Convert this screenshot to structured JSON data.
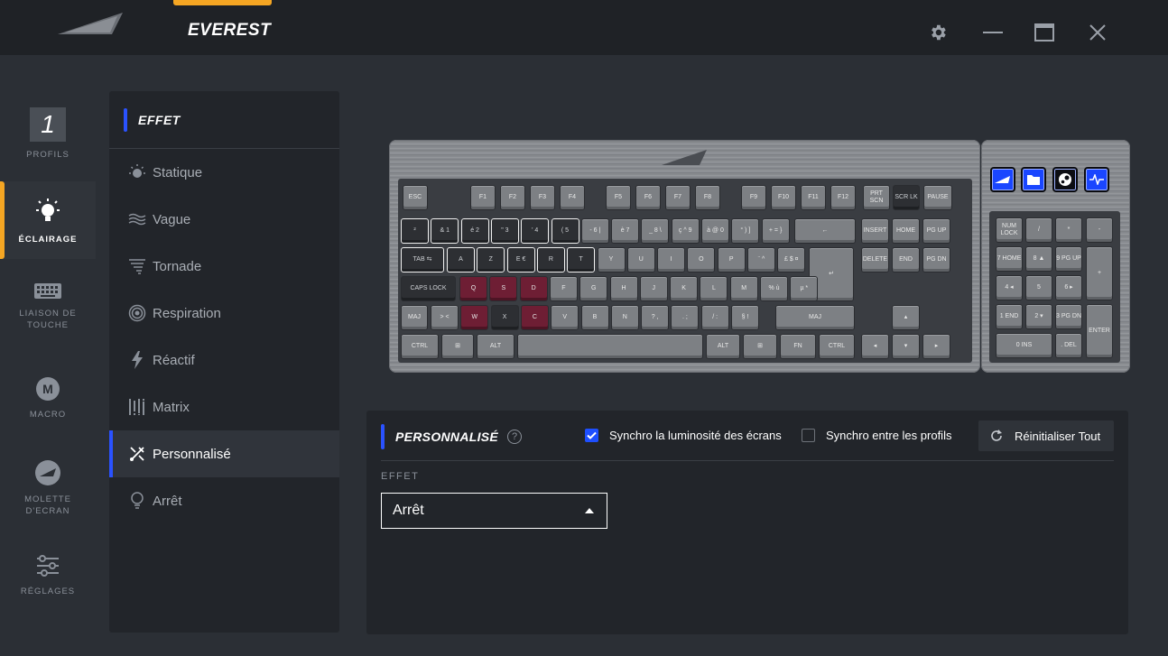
{
  "app": {
    "device_name": "EVEREST",
    "brand_color": "#f5a623",
    "accent_color": "#2a52ff"
  },
  "window_controls": {
    "settings_icon": "gear-icon",
    "minimize_icon": "minimize-icon",
    "maximize_icon": "maximize-icon",
    "close_icon": "close-icon"
  },
  "rail": {
    "profile_number": "1",
    "items": [
      {
        "label": "PROFILS",
        "icon": "profile-number-box"
      },
      {
        "label": "ÉCLAIRAGE",
        "icon": "lightbulb-icon",
        "active": true
      },
      {
        "label": "LIAISON DE TOUCHE",
        "icon": "keyboard-icon"
      },
      {
        "label": "MACRO",
        "icon": "macro-m-icon"
      },
      {
        "label": "MOLETTE D'ECRAN",
        "icon": "dial-icon"
      },
      {
        "label": "RÉGLAGES",
        "icon": "sliders-icon"
      }
    ]
  },
  "effects": {
    "header": "EFFET",
    "items": [
      {
        "label": "Statique",
        "icon": "sun-icon"
      },
      {
        "label": "Vague",
        "icon": "wave-icon"
      },
      {
        "label": "Tornade",
        "icon": "tornado-icon"
      },
      {
        "label": "Respiration",
        "icon": "breathing-icon"
      },
      {
        "label": "Réactif",
        "icon": "lightning-icon"
      },
      {
        "label": "Matrix",
        "icon": "matrix-icon"
      },
      {
        "label": "Personnalisé",
        "icon": "custom-brush-icon",
        "active": true
      },
      {
        "label": "Arrêt",
        "icon": "bulb-off-icon"
      }
    ]
  },
  "keyboard": {
    "function_row": [
      "ESC",
      "F1",
      "F2",
      "F3",
      "F4",
      "F5",
      "F6",
      "F7",
      "F8",
      "F9",
      "F10",
      "F11",
      "F12",
      "PRT SCN",
      "SCR LK",
      "PAUSE"
    ],
    "nav_top": [
      "INSERT",
      "HOME",
      "PG UP"
    ],
    "nav_mid": [
      "DELETE",
      "END",
      "PG DN"
    ],
    "numpad": [
      "NUM LOCK",
      "/",
      "*",
      "-",
      "7 HOME",
      "8 ▲",
      "9 PG UP",
      "+",
      "4 ◂",
      "5",
      "6 ▸",
      "1 END",
      "2 ▾",
      "3 PG DN",
      "ENTER",
      "0 INS",
      ". DEL"
    ],
    "media_keys": [
      "media-logo-key",
      "folder-key",
      "steam-key",
      "pulse-key"
    ],
    "row1": [
      "²",
      "& 1",
      "é 2",
      "\" 3",
      "' 4",
      "( 5",
      "- 6 |",
      "è 7",
      "_ 8 \\",
      "ç ^ 9",
      "à @ 0",
      "° ) ]",
      "+ = }",
      "←"
    ],
    "row2": [
      "TAB ⇆",
      "A",
      "Z",
      "E €",
      "R",
      "T",
      "Y",
      "U",
      "I",
      "O",
      "P",
      "¨ ^",
      "£ $ ¤",
      "↵"
    ],
    "row3": [
      "CAPS LOCK",
      "Q",
      "S",
      "D",
      "F",
      "G",
      "H",
      "J",
      "K",
      "L",
      "M",
      "% ù",
      "µ *"
    ],
    "row4": [
      "MAJ",
      "> <",
      "W",
      "X",
      "C",
      "V",
      "B",
      "N",
      "? ,",
      ". ;",
      "/ :",
      "§ !",
      "MAJ"
    ],
    "row5": [
      "CTRL",
      "⊞",
      "ALT",
      "",
      "ALT",
      "⊞",
      "FN",
      "CTRL"
    ],
    "arrows": [
      "▴",
      "◂",
      "▾",
      "▸"
    ],
    "highlight_color": "#6e1e34"
  },
  "custom": {
    "title": "PERSONNALISÉ",
    "help": "?",
    "sync_brightness_label": "Synchro la luminosité des écrans",
    "sync_brightness_checked": true,
    "sync_profiles_label": "Synchro entre les profils",
    "sync_profiles_checked": false,
    "reset_label": "Réinitialiser Tout",
    "effect_label": "EFFET",
    "effect_value": "Arrêt"
  }
}
